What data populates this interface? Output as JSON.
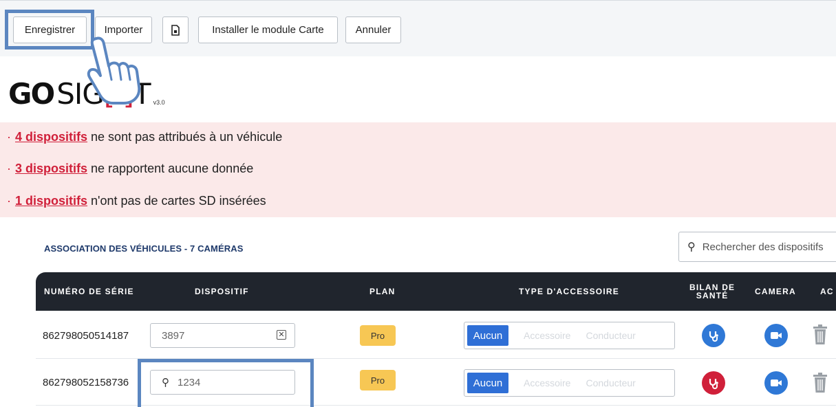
{
  "toolbar": {
    "save_label": "Enregistrer",
    "import_label": "Importer",
    "install_label": "Installer le module Carte",
    "cancel_label": "Annuler",
    "file_icon": "file-icon"
  },
  "logo": {
    "brand_go": "GO",
    "brand_sight": "SIGHT",
    "version": "v3.0"
  },
  "alerts": [
    {
      "link": "4 dispositifs",
      "text": "ne sont pas attribués à un véhicule"
    },
    {
      "link": "3 dispositifs",
      "text": "ne rapportent aucune donnée"
    },
    {
      "link": "1 dispositifs",
      "text": "n'ont pas de cartes SD insérées"
    }
  ],
  "section": {
    "title": "ASSOCIATION DES VÉHICULES - 7 CAMÉRAS",
    "search_placeholder": "Rechercher des dispositifs"
  },
  "table": {
    "headers": {
      "serial": "NUMÉRO DE SÉRIE",
      "device": "DISPOSITIF",
      "plan": "PLAN",
      "accessory": "TYPE D'ACCESSOIRE",
      "health_line1": "BILAN DE",
      "health_line2": "SANTÉ",
      "camera": "CAMERA",
      "actions": "AC"
    },
    "rows": [
      {
        "serial": "862798050514187",
        "device": "3897",
        "plan": "Pro",
        "acc_on": "Aucun",
        "acc_2": "Accessoire",
        "acc_3": "Conducteur",
        "health": "ok"
      },
      {
        "serial": "862798052158736",
        "device": "1234",
        "plan": "Pro",
        "acc_on": "Aucun",
        "acc_2": "Accessoire",
        "acc_3": "Conducteur",
        "health": "alert"
      }
    ]
  },
  "colors": {
    "accent": "#2f6fd6",
    "danger": "#d0203a",
    "highlight": "#5b86c0",
    "plan_badge": "#f7c754"
  }
}
